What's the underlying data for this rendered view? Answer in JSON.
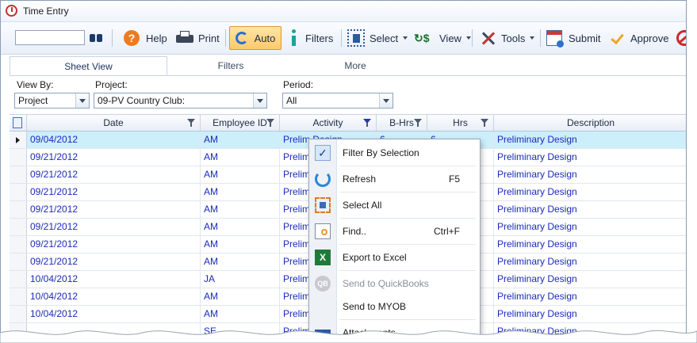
{
  "window": {
    "title": "Time Entry"
  },
  "toolbar": {
    "search_value": "",
    "help": "Help",
    "print": "Print",
    "auto": "Auto",
    "filters": "Filters",
    "select": "Select",
    "view": "View",
    "tools": "Tools",
    "submit": "Submit",
    "approve": "Approve"
  },
  "tabs": [
    "Sheet View",
    "Filters",
    "More"
  ],
  "filters": {
    "view_by_label": "View By:",
    "view_by_value": "Project",
    "project_label": "Project:",
    "project_value": "09-PV Country Club:",
    "period_label": "Period:",
    "period_value": "All"
  },
  "grid": {
    "columns": [
      "Date",
      "Employee ID",
      "Activity",
      "B-Hrs",
      "Hrs",
      "Description"
    ],
    "rows": [
      {
        "date": "09/04/2012",
        "emp": "AM",
        "activity": "Prelim Design",
        "bhrs": "6",
        "hrs": "6",
        "desc": "Preliminary Design"
      },
      {
        "date": "09/21/2012",
        "emp": "AM",
        "activity": "Prelim",
        "bhrs": "",
        "hrs": "",
        "desc": "Preliminary Design"
      },
      {
        "date": "09/21/2012",
        "emp": "AM",
        "activity": "Prelim",
        "bhrs": "",
        "hrs": "",
        "desc": "Preliminary Design"
      },
      {
        "date": "09/21/2012",
        "emp": "AM",
        "activity": "Prelim",
        "bhrs": "",
        "hrs": "",
        "desc": "Preliminary Design"
      },
      {
        "date": "09/21/2012",
        "emp": "AM",
        "activity": "Prelim",
        "bhrs": "",
        "hrs": "",
        "desc": "Preliminary Design"
      },
      {
        "date": "09/21/2012",
        "emp": "AM",
        "activity": "Prelim",
        "bhrs": "",
        "hrs": "",
        "desc": "Preliminary Design"
      },
      {
        "date": "09/21/2012",
        "emp": "AM",
        "activity": "Prelim",
        "bhrs": "",
        "hrs": "",
        "desc": "Preliminary Design"
      },
      {
        "date": "09/21/2012",
        "emp": "AM",
        "activity": "Prelim",
        "bhrs": "",
        "hrs": "",
        "desc": "Preliminary Design"
      },
      {
        "date": "10/04/2012",
        "emp": "JA",
        "activity": "Prelim",
        "bhrs": "",
        "hrs": "",
        "desc": "Preliminary Design"
      },
      {
        "date": "10/04/2012",
        "emp": "AM",
        "activity": "Prelim",
        "bhrs": "",
        "hrs": "",
        "desc": "Preliminary Design"
      },
      {
        "date": "10/04/2012",
        "emp": "AM",
        "activity": "Prelim",
        "bhrs": "",
        "hrs": "",
        "desc": "Preliminary Design"
      },
      {
        "date": "",
        "emp": "SE",
        "activity": "Prelim",
        "bhrs": "",
        "hrs": "",
        "desc": "Preliminary Design"
      }
    ]
  },
  "context_menu": {
    "items": [
      {
        "label": "Filter By Selection",
        "shortcut": ""
      },
      {
        "label": "Refresh",
        "shortcut": "F5"
      },
      {
        "label": "Select All",
        "shortcut": ""
      },
      {
        "label": "Find..",
        "shortcut": "Ctrl+F"
      },
      {
        "label": "Export to Excel",
        "shortcut": ""
      },
      {
        "label": "Send to QuickBooks",
        "shortcut": ""
      },
      {
        "label": "Send to MYOB",
        "shortcut": ""
      },
      {
        "label": "Attachments",
        "shortcut": ""
      }
    ],
    "check_glyph": "✓",
    "excel_glyph": "X",
    "qb_glyph": "QB"
  },
  "icons": {
    "search": "binoculars-icon",
    "help": "help-icon",
    "print": "printer-icon",
    "auto": "refresh-icon",
    "filters": "info-icon",
    "select": "select-icon",
    "view": "view-dollar-icon",
    "tools": "tools-icon",
    "submit": "calendar-submit-icon",
    "approve": "checkmark-icon",
    "deny": "no-entry-icon"
  },
  "colors": {
    "accent": "#2a6fd6",
    "selected_row": "#cdeefb",
    "link_text": "#1a2bb8",
    "auto_button": "#ffc96a",
    "help_orange": "#f07a1e"
  }
}
